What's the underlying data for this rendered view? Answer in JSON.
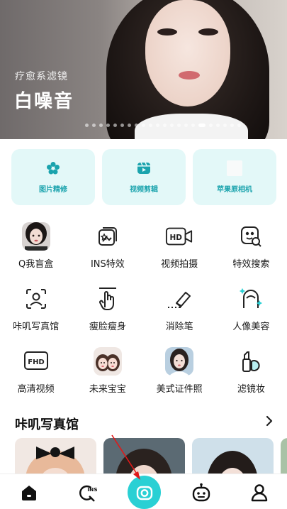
{
  "banner": {
    "subtitle": "疗愈系滤镜",
    "title": "白噪音",
    "dot_count": 22,
    "active_dot": 16
  },
  "feature_cards": [
    {
      "label": "图片精修",
      "icon": "flower-icon"
    },
    {
      "label": "视频剪辑",
      "icon": "video-clip-icon"
    },
    {
      "label": "苹果原相机",
      "icon": "apple-camera-icon"
    }
  ],
  "tools": [
    [
      {
        "label": "Q我盲盒",
        "icon": "girl-avatar"
      },
      {
        "label": "INS特效",
        "icon": "ins-effect-icon"
      },
      {
        "label": "视频拍摄",
        "icon": "hd-video-icon"
      },
      {
        "label": "特效搜索",
        "icon": "effect-search-icon"
      }
    ],
    [
      {
        "label": "咔叽写真馆",
        "icon": "portrait-frame-icon"
      },
      {
        "label": "瘦脸瘦身",
        "icon": "slim-hand-icon"
      },
      {
        "label": "消除笔",
        "icon": "eraser-icon"
      },
      {
        "label": "人像美容",
        "icon": "beauty-face-icon"
      }
    ],
    [
      {
        "label": "高清视频",
        "icon": "fhd-icon"
      },
      {
        "label": "未来宝宝",
        "icon": "baby-avatar"
      },
      {
        "label": "美式证件照",
        "icon": "id-photo-avatar"
      },
      {
        "label": "滤镜妆",
        "icon": "makeup-filter-icon"
      }
    ]
  ],
  "section": {
    "title": "咔叽写真馆",
    "more_icon": "chevron-right-icon"
  },
  "nav": {
    "items": [
      "home-icon",
      "ins-search-icon",
      "camera-icon",
      "robot-icon",
      "profile-icon"
    ]
  },
  "colors": {
    "accent": "#2ad0d4",
    "card_bg": "#e3f8f8",
    "card_label": "#1aa3ad"
  }
}
